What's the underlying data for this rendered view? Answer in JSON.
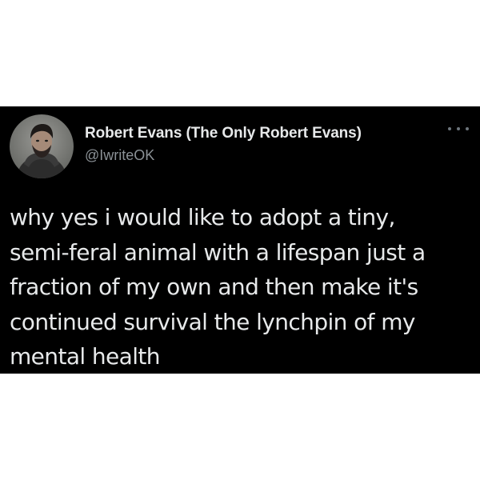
{
  "tweet": {
    "author": {
      "display_name": "Robert Evans (The Only Robert Evans)",
      "handle": "@IwriteOK",
      "avatar_icon": "profile-photo"
    },
    "more_icon": "more-horizontal-icon",
    "text": "why yes i would like to adopt a tiny,\nsemi-feral animal with a lifespan just a\nfraction of my own and then make it's\ncontinued survival the lynchpin of my\nmental health"
  },
  "colors": {
    "card_background": "#000000",
    "page_background": "#ffffff",
    "text_primary": "#e7e9ea",
    "text_secondary": "#8b9196"
  }
}
